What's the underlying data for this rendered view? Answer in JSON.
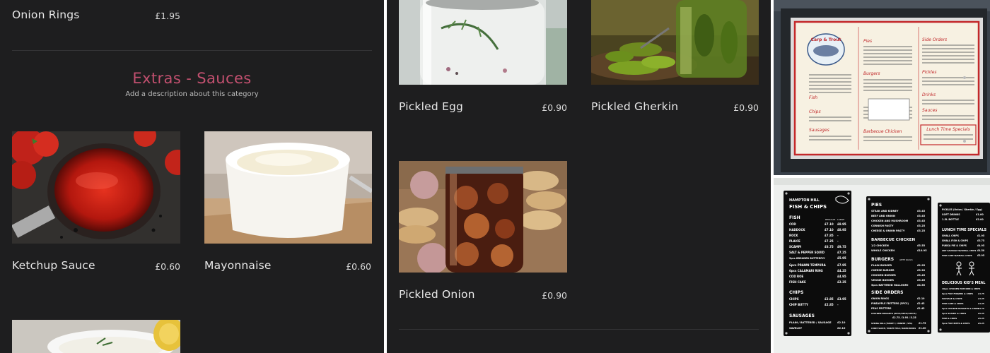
{
  "left_panel": {
    "top_item": {
      "name": "Onion Rings",
      "price": "£1.95"
    },
    "category": {
      "title": "Extras - Sauces",
      "description": "Add a description about this category"
    },
    "items": [
      {
        "name": "Ketchup Sauce",
        "price": "£0.60"
      },
      {
        "name": "Mayonnaise",
        "price": "£0.60"
      }
    ]
  },
  "middle_panel": {
    "items": [
      {
        "name": "Pickled Egg",
        "price": "£0.90"
      },
      {
        "name": "Pickled Gherkin",
        "price": "£0.90"
      },
      {
        "name": "Pickled Onion",
        "price": "£0.90"
      }
    ]
  },
  "colors": {
    "panel_background": "#1e1e1f",
    "category_title": "#c2506f",
    "text": "#e8e8e8"
  },
  "photos": {
    "top": {
      "menu_heading": "Carp & Trout",
      "sections_left": [
        "Fish",
        "Chips",
        "Sausages"
      ],
      "sections_middle": [
        "Pies",
        "Burgers",
        "Barbecue Chicken"
      ],
      "sections_right": [
        "Side Orders",
        "Pickles",
        "Drinks",
        "Sauces"
      ],
      "lunch_box": "Lunch Time Specials"
    },
    "bottom": {
      "board1": {
        "title_line1": "HAMPTON HILL",
        "title_line2": "FISH & CHIPS",
        "section1": "FISH",
        "col_regular": "REGULAR",
        "col_large": "LARGE",
        "rows": [
          {
            "name": "COD",
            "price1": "£7.10",
            "price2": "£8.95"
          },
          {
            "name": "HADDOCK",
            "price1": "£7.10",
            "price2": "£8.95"
          },
          {
            "name": "ROCK",
            "price1": "£7.85",
            "price2": "-"
          },
          {
            "name": "PLAICE",
            "price1": "£7.25",
            "price2": "-"
          },
          {
            "name": "SCAMPI",
            "price1": "£6.75",
            "price2": "£9.75"
          },
          {
            "name": "SALT & PEPPER SQUID",
            "price1": "",
            "price2": "£7.25"
          },
          {
            "name": "5pcs BREADED BUTTERFLY",
            "price1": "",
            "price2": "£5.95"
          },
          {
            "name": "6pcs PRAWN TEMPURA",
            "price1": "",
            "price2": "£7.95"
          },
          {
            "name": "6pcs CALAMARI RING",
            "price1": "",
            "price2": "£4.25"
          },
          {
            "name": "COD ROE",
            "price1": "",
            "price2": "£4.95"
          },
          {
            "name": "FISH CAKE",
            "price1": "",
            "price2": "£2.25"
          }
        ],
        "section2": "CHIPS",
        "chip_rows": [
          {
            "name": "CHIPS",
            "price1": "£2.85",
            "price2": "£3.95"
          },
          {
            "name": "CHIP BUTTY",
            "price1": "£2.85",
            "price2": "-"
          }
        ],
        "section3": "SAUSAGES",
        "sausage_rows": [
          {
            "name": "PLAIN / BATTERED / SAUSAGE",
            "price": "£2.10"
          },
          {
            "name": "SAVELOY",
            "price": "£2.10"
          }
        ]
      },
      "board2": {
        "section1": "PIES",
        "pie_rows": [
          {
            "name": "STEAK AND KIDNEY",
            "price": "£3.45"
          },
          {
            "name": "BEEF AND ONION",
            "price": "£3.45"
          },
          {
            "name": "CHICKEN AND MUSHROOM",
            "price": "£3.45"
          },
          {
            "name": "CORNISH PASTY",
            "price": "£3.25"
          },
          {
            "name": "CHEESE & ONION PASTY",
            "price": "£3.25"
          }
        ],
        "section2": "BARBECUE CHICKEN",
        "bbq_rows": [
          {
            "name": "1/2 CHICKEN",
            "price": "£5.55"
          },
          {
            "name": "WHOLE CHICKEN",
            "price": "£10.95"
          }
        ],
        "section3": "BURGERS",
        "burger_note": "(WITH SALAD)",
        "burger_rows": [
          {
            "name": "PLAIN BURGER",
            "price": "£2.95"
          },
          {
            "name": "CHEESE BURGER",
            "price": "£3.20"
          },
          {
            "name": "CHICKEN BURGER",
            "price": "£3.45"
          },
          {
            "name": "VEGGIE BURGER",
            "price": "£3.45"
          },
          {
            "name": "5pcs BATTERED HALLOUMI",
            "price": "£4.50"
          }
        ],
        "section4": "SIDE ORDERS",
        "side_rows": [
          {
            "name": "ONION RINGS",
            "price": "£2.10"
          },
          {
            "name": "PINEAPPLE FRITTERS (5PCS)",
            "price": "£2.45"
          },
          {
            "name": "PEAS FRITTERS",
            "price": "£2.45"
          },
          {
            "name": "CHICKEN NUGGETS (6PCS/9PCS/12PCS)",
            "price": ""
          },
          {
            "name": "£2.75 / 3.95 / 5.25",
            "price": ""
          },
          {
            "name": "SPRING ROLL (TURKEY / CHINESE / VEG)",
            "price": "£1.75"
          },
          {
            "name": "CURRY SAUCE / MUSHY PEAS / BAKED BEANS",
            "price": "£1.20"
          }
        ]
      },
      "board3": {
        "heading_line": "PICKLES (Onion / Gherkin / Egg)",
        "top_rows": [
          {
            "name": "SOFT DRINKS",
            "price": "£1.00"
          },
          {
            "name": "1.5L BOTTLE",
            "price": "£2.00"
          }
        ],
        "section1": "LUNCH TIME SPECIALS",
        "lunch_rows": [
          {
            "name": "SMALL CHIPS",
            "price": "£1.95"
          },
          {
            "name": "SMALL FISH & CHIPS",
            "price": "£5.75"
          },
          {
            "name": "PUKKA PIE & CHIPS",
            "price": "£4.95"
          },
          {
            "name": "ANY SAUSAGE W/SMALL CHIPS",
            "price": "£4.50"
          },
          {
            "name": "FISH CAKE W/SMALL CHIPS",
            "price": "£3.95"
          }
        ],
        "section2": "DELICIOUS KID'S MEAL",
        "kids_note": "10pcs CHICKEN POPCORN & CHIPS",
        "kids_rows": [
          {
            "name": "6pcs FISH FINGERS & CHIPS",
            "price": "£4.75"
          },
          {
            "name": "SAUSAGE & CHIPS",
            "price": "£4.25"
          },
          {
            "name": "FISH CAKE & CHIPS",
            "price": "£4.25"
          },
          {
            "name": "5pcs CHICKEN NUGGETS & CHIPS",
            "price": "£4.75"
          },
          {
            "name": "5pcs SCAMPI & CHIPS",
            "price": "£5.25"
          },
          {
            "name": "FISH & CHIPS",
            "price": "£5.25"
          },
          {
            "name": "5pcs FISH BITES & CHIPS",
            "price": "£5.25"
          }
        ]
      }
    }
  }
}
